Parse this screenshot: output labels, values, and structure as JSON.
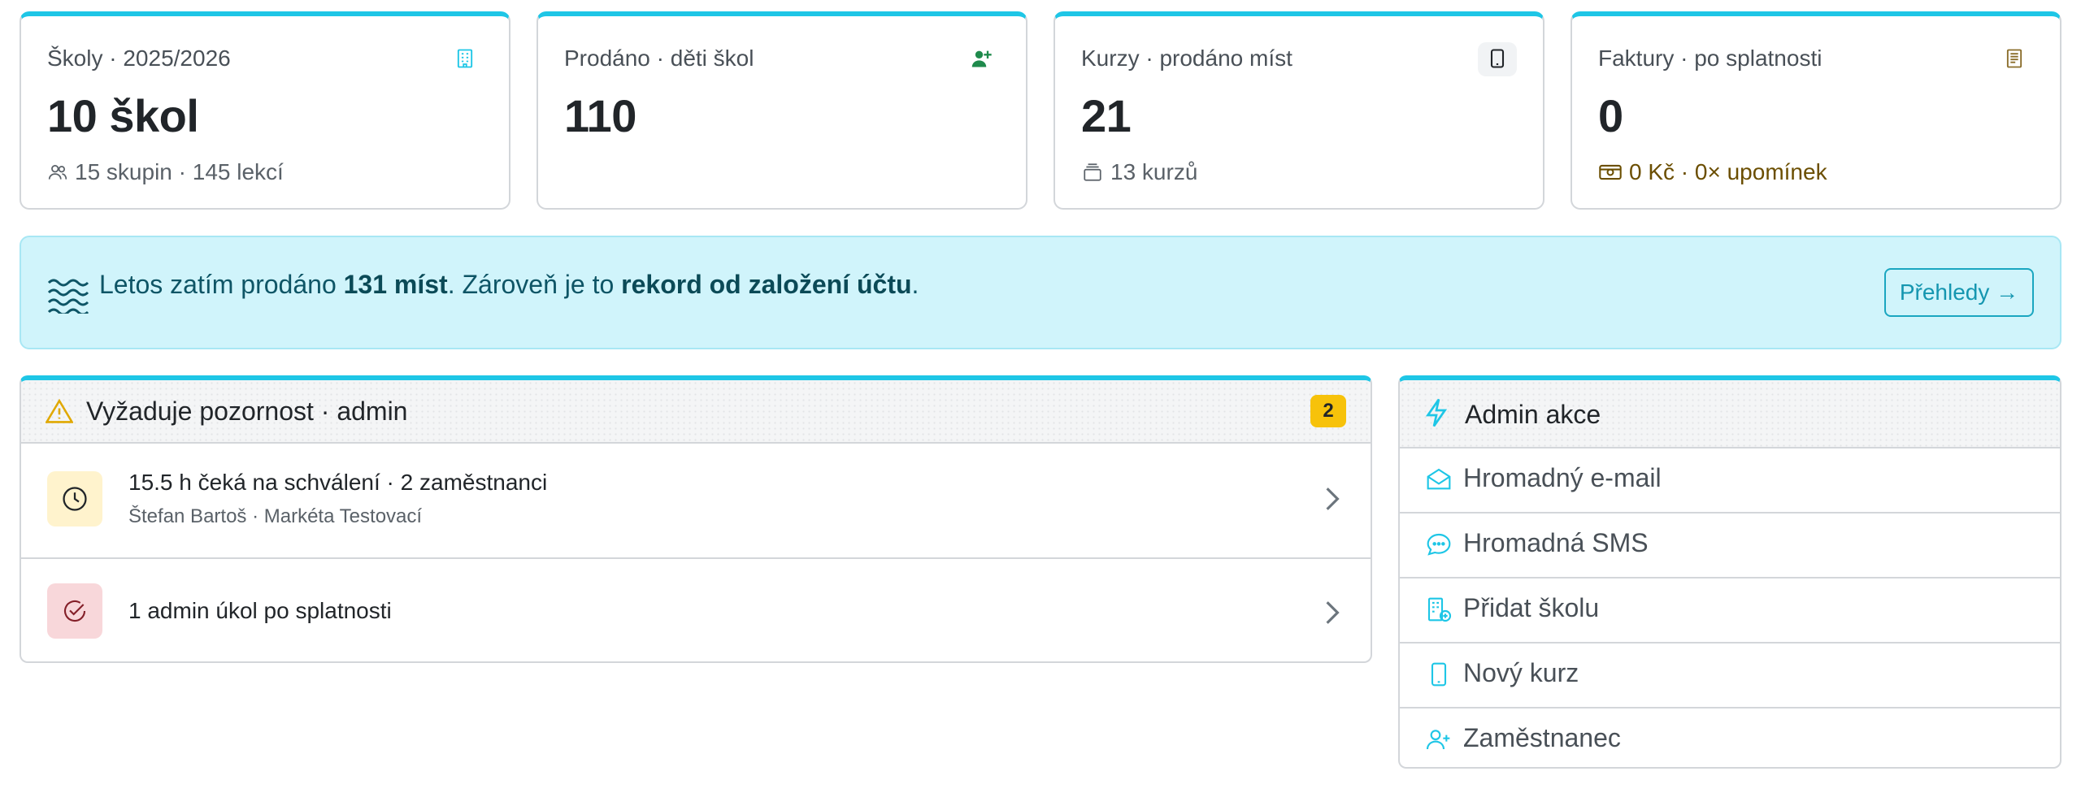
{
  "cards": [
    {
      "label": "Školy · 2025/2026",
      "value": "10 škol",
      "sub": "15 skupin · 145 lekcí",
      "icon": "building-icon"
    },
    {
      "label": "Prodáno · děti škol",
      "value": "110",
      "sub": "",
      "icon": "user-add-icon"
    },
    {
      "label": "Kurzy · prodáno míst",
      "value": "21",
      "sub": "13 kurzů",
      "icon": "tablet-icon"
    },
    {
      "label": "Faktury · po splatnosti",
      "value": "0",
      "sub": "0 Kč · 0× upomínek",
      "icon": "receipt-icon"
    }
  ],
  "banner": {
    "pre": "Letos zatím prodáno ",
    "count": "131 míst",
    "mid": ". Zároveň je to ",
    "record": "rekord od založení účtu",
    "post": ".",
    "button": "Přehledy →"
  },
  "attention": {
    "title": "Vyžaduje pozornost · admin",
    "badge": "2",
    "items": [
      {
        "title": "15.5 h čeká na schválení · 2 zaměstnanci",
        "sub": "Štefan Bartoš · Markéta Testovací"
      },
      {
        "title": "1 admin úkol po splatnosti",
        "sub": ""
      }
    ]
  },
  "admin": {
    "title": "Admin akce",
    "actions": [
      {
        "label": "Hromadný e-mail",
        "icon": "envelope-icon"
      },
      {
        "label": "Hromadná SMS",
        "icon": "chat-icon"
      },
      {
        "label": "Přidat školu",
        "icon": "building-add-icon"
      },
      {
        "label": "Nový kurz",
        "icon": "tablet-icon"
      },
      {
        "label": "Zaměstnanec",
        "icon": "person-add-icon"
      }
    ]
  },
  "colors": {
    "accent": "#1ec6e6",
    "banner_bg": "#d0f4fb",
    "badge": "#f7c20a"
  }
}
